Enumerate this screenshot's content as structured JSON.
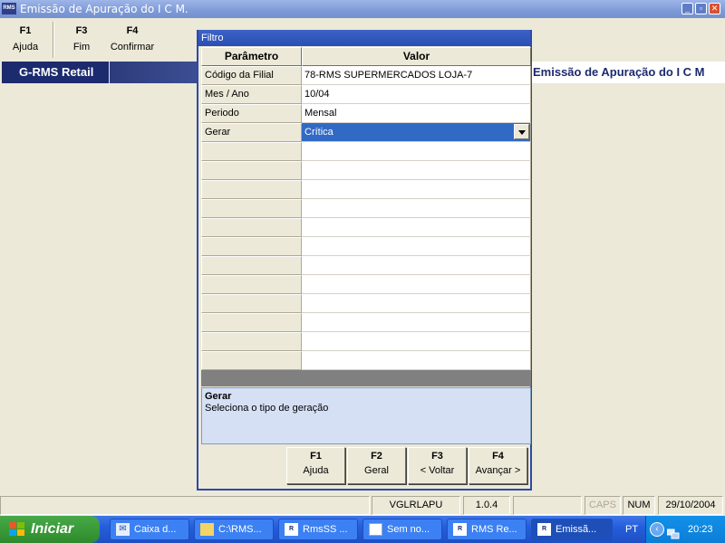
{
  "window": {
    "icon_label": "RMS",
    "title": "Emissão de Apuração do I C M.",
    "controls": {
      "minimize": "_",
      "restore": "▫",
      "close": "✕"
    }
  },
  "toolbar": [
    {
      "key": "F1",
      "label": "Ajuda"
    },
    {
      "key": "F3",
      "label": "Fim"
    },
    {
      "key": "F4",
      "label": "Confirmar"
    }
  ],
  "appbar": {
    "brand": "G-RMS Retail",
    "module_title": "Emissão de Apuração do I C M"
  },
  "dialog": {
    "title": "Filtro",
    "headers": {
      "param": "Parâmetro",
      "value": "Valor"
    },
    "rows": [
      {
        "param": "Código da Filial",
        "value": "78-RMS   SUPERMERCADOS LOJA-7"
      },
      {
        "param": "Mes / Ano",
        "value": "10/04"
      },
      {
        "param": "Periodo",
        "value": "Mensal"
      },
      {
        "param": "Gerar",
        "value": "Crítica"
      }
    ],
    "help": {
      "title": "Gerar",
      "text": "Seleciona o tipo de geração"
    },
    "buttons": [
      {
        "key": "F1",
        "label": "Ajuda"
      },
      {
        "key": "F2",
        "label": "Geral"
      },
      {
        "key": "F3",
        "label": "< Voltar"
      },
      {
        "key": "F4",
        "label": "Avançar >"
      }
    ]
  },
  "statusbar": {
    "program": "VGLRLAPU",
    "version": "1.0.4",
    "caps": "CAPS",
    "num": "NUM",
    "date": "29/10/2004"
  },
  "taskbar": {
    "start_label": "Iniciar",
    "tasks": [
      {
        "label": "Caixa d...",
        "icon": "inbox-icon"
      },
      {
        "label": "C:\\RMS...",
        "icon": "folder-icon"
      },
      {
        "label": "RmsSS ...",
        "icon": "rms-icon"
      },
      {
        "label": "Sem no...",
        "icon": "notepad-icon"
      },
      {
        "label": "RMS Re...",
        "icon": "rms-icon"
      },
      {
        "label": "Emissã...",
        "icon": "rms-icon",
        "active": true
      }
    ],
    "language": "PT",
    "clock": "20:23"
  }
}
